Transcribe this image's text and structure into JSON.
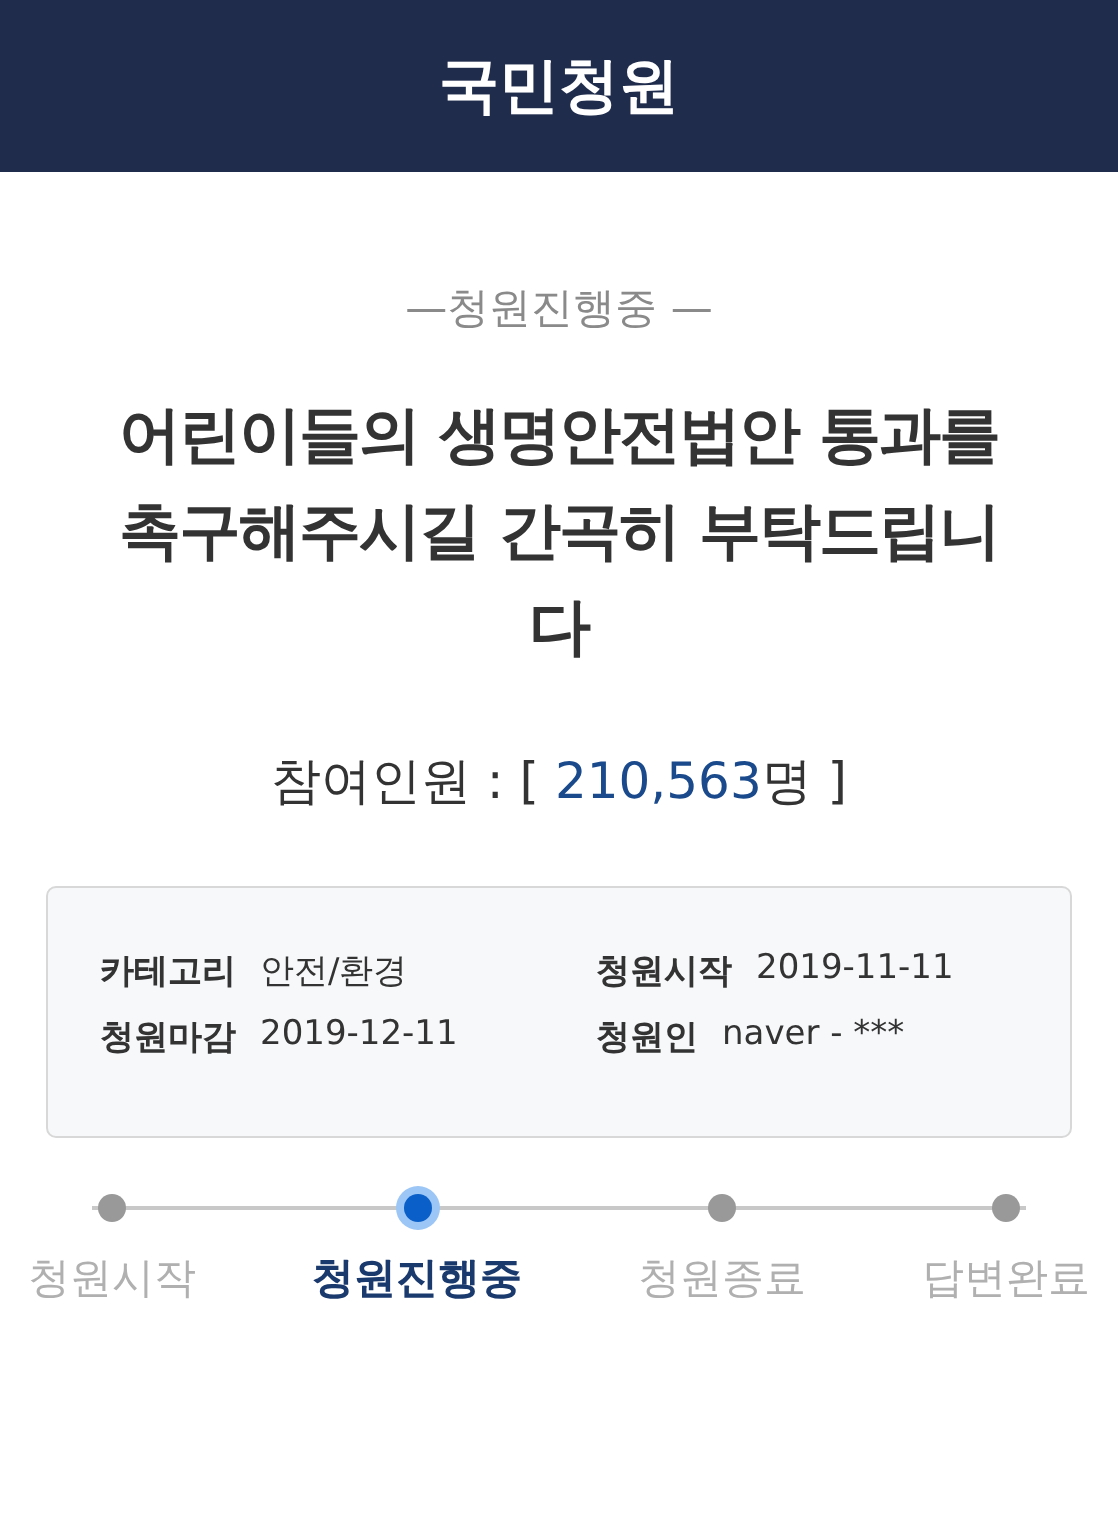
{
  "header": {
    "title": "국민청원"
  },
  "status": {
    "text": "—청원진행중 —"
  },
  "petition": {
    "title_lines": [
      "어린이들의 생명안전법안 통과를",
      "촉구해주시길 간곡히 부탁드립니",
      "다"
    ],
    "participants": {
      "label": "참여인원 :",
      "open": "[",
      "count": "210,563",
      "unit": "명",
      "close": "]"
    }
  },
  "info": [
    {
      "label": "카테고리",
      "value": "안전/환경"
    },
    {
      "label": "청원시작",
      "value": "2019-11-11"
    },
    {
      "label": "청원마감",
      "value": "2019-12-11"
    },
    {
      "label": "청원인",
      "value": "naver - ***"
    }
  ],
  "steps": [
    {
      "label": "청원시작",
      "selected": false
    },
    {
      "label": "청원진행중",
      "selected": true
    },
    {
      "label": "청원종료",
      "selected": false
    },
    {
      "label": "답변완료",
      "selected": false
    }
  ]
}
